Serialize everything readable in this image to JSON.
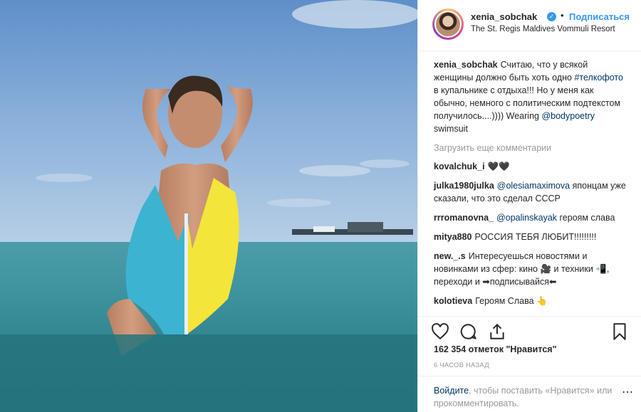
{
  "header": {
    "username": "xenia_sobchak",
    "dot": "•",
    "follow_label": "Подписаться",
    "location": "The St. Regis Maldives Vommuli Resort"
  },
  "caption": {
    "username": "xenia_sobchak",
    "text_1": "Считаю, что у всякой женщины должно быть хоть одно",
    "hashtag": "#телкофото",
    "text_2": "в купальнике с отдыха!!! Но у меня как обычно, немного с политическим подтекстом получилось....)))) Wearing",
    "mention": "@bodypoetry",
    "text_3": "swimsuit"
  },
  "load_more": "Загрузить еще комментарии",
  "comments": [
    {
      "user": "kovalchuk_i",
      "text": "🖤🖤"
    },
    {
      "user": "julka1980julka",
      "mention": "@olesiamaximova",
      "text": "японцам уже сказали, что это сделал СССР"
    },
    {
      "user": "rrromanovna_",
      "mention": "@opalinskayak",
      "text": "героям слава"
    },
    {
      "user": "mitya880",
      "text": "РОССИЯ ТЕБЯ ЛЮБИТ!!!!!!!!!"
    },
    {
      "user": "new._.s",
      "text": "Интересуешься новостями и новинками из сфер: кино 🎥 и техники 📲, переходи и ➡подписывайся⬅"
    },
    {
      "user": "kolotieva",
      "text": "Героям Слава 👆"
    }
  ],
  "likes": "162 354 отметок \"Нравится\"",
  "timestamp": "6 ЧАСОВ НАЗАД",
  "login": {
    "link": "Войдите",
    "text": ", чтобы поставить «Нравится» или прокомментировать."
  },
  "more_icon": "⋯",
  "icons": [
    "heart-icon",
    "comment-icon",
    "share-icon",
    "bookmark-icon",
    "verified-badge-icon",
    "more-options-icon"
  ],
  "colors": {
    "accent": "#3897f0",
    "link": "#003569",
    "muted": "#999999",
    "swimsuit_blue": "#3cb3d1",
    "swimsuit_yellow": "#f3e53a"
  }
}
